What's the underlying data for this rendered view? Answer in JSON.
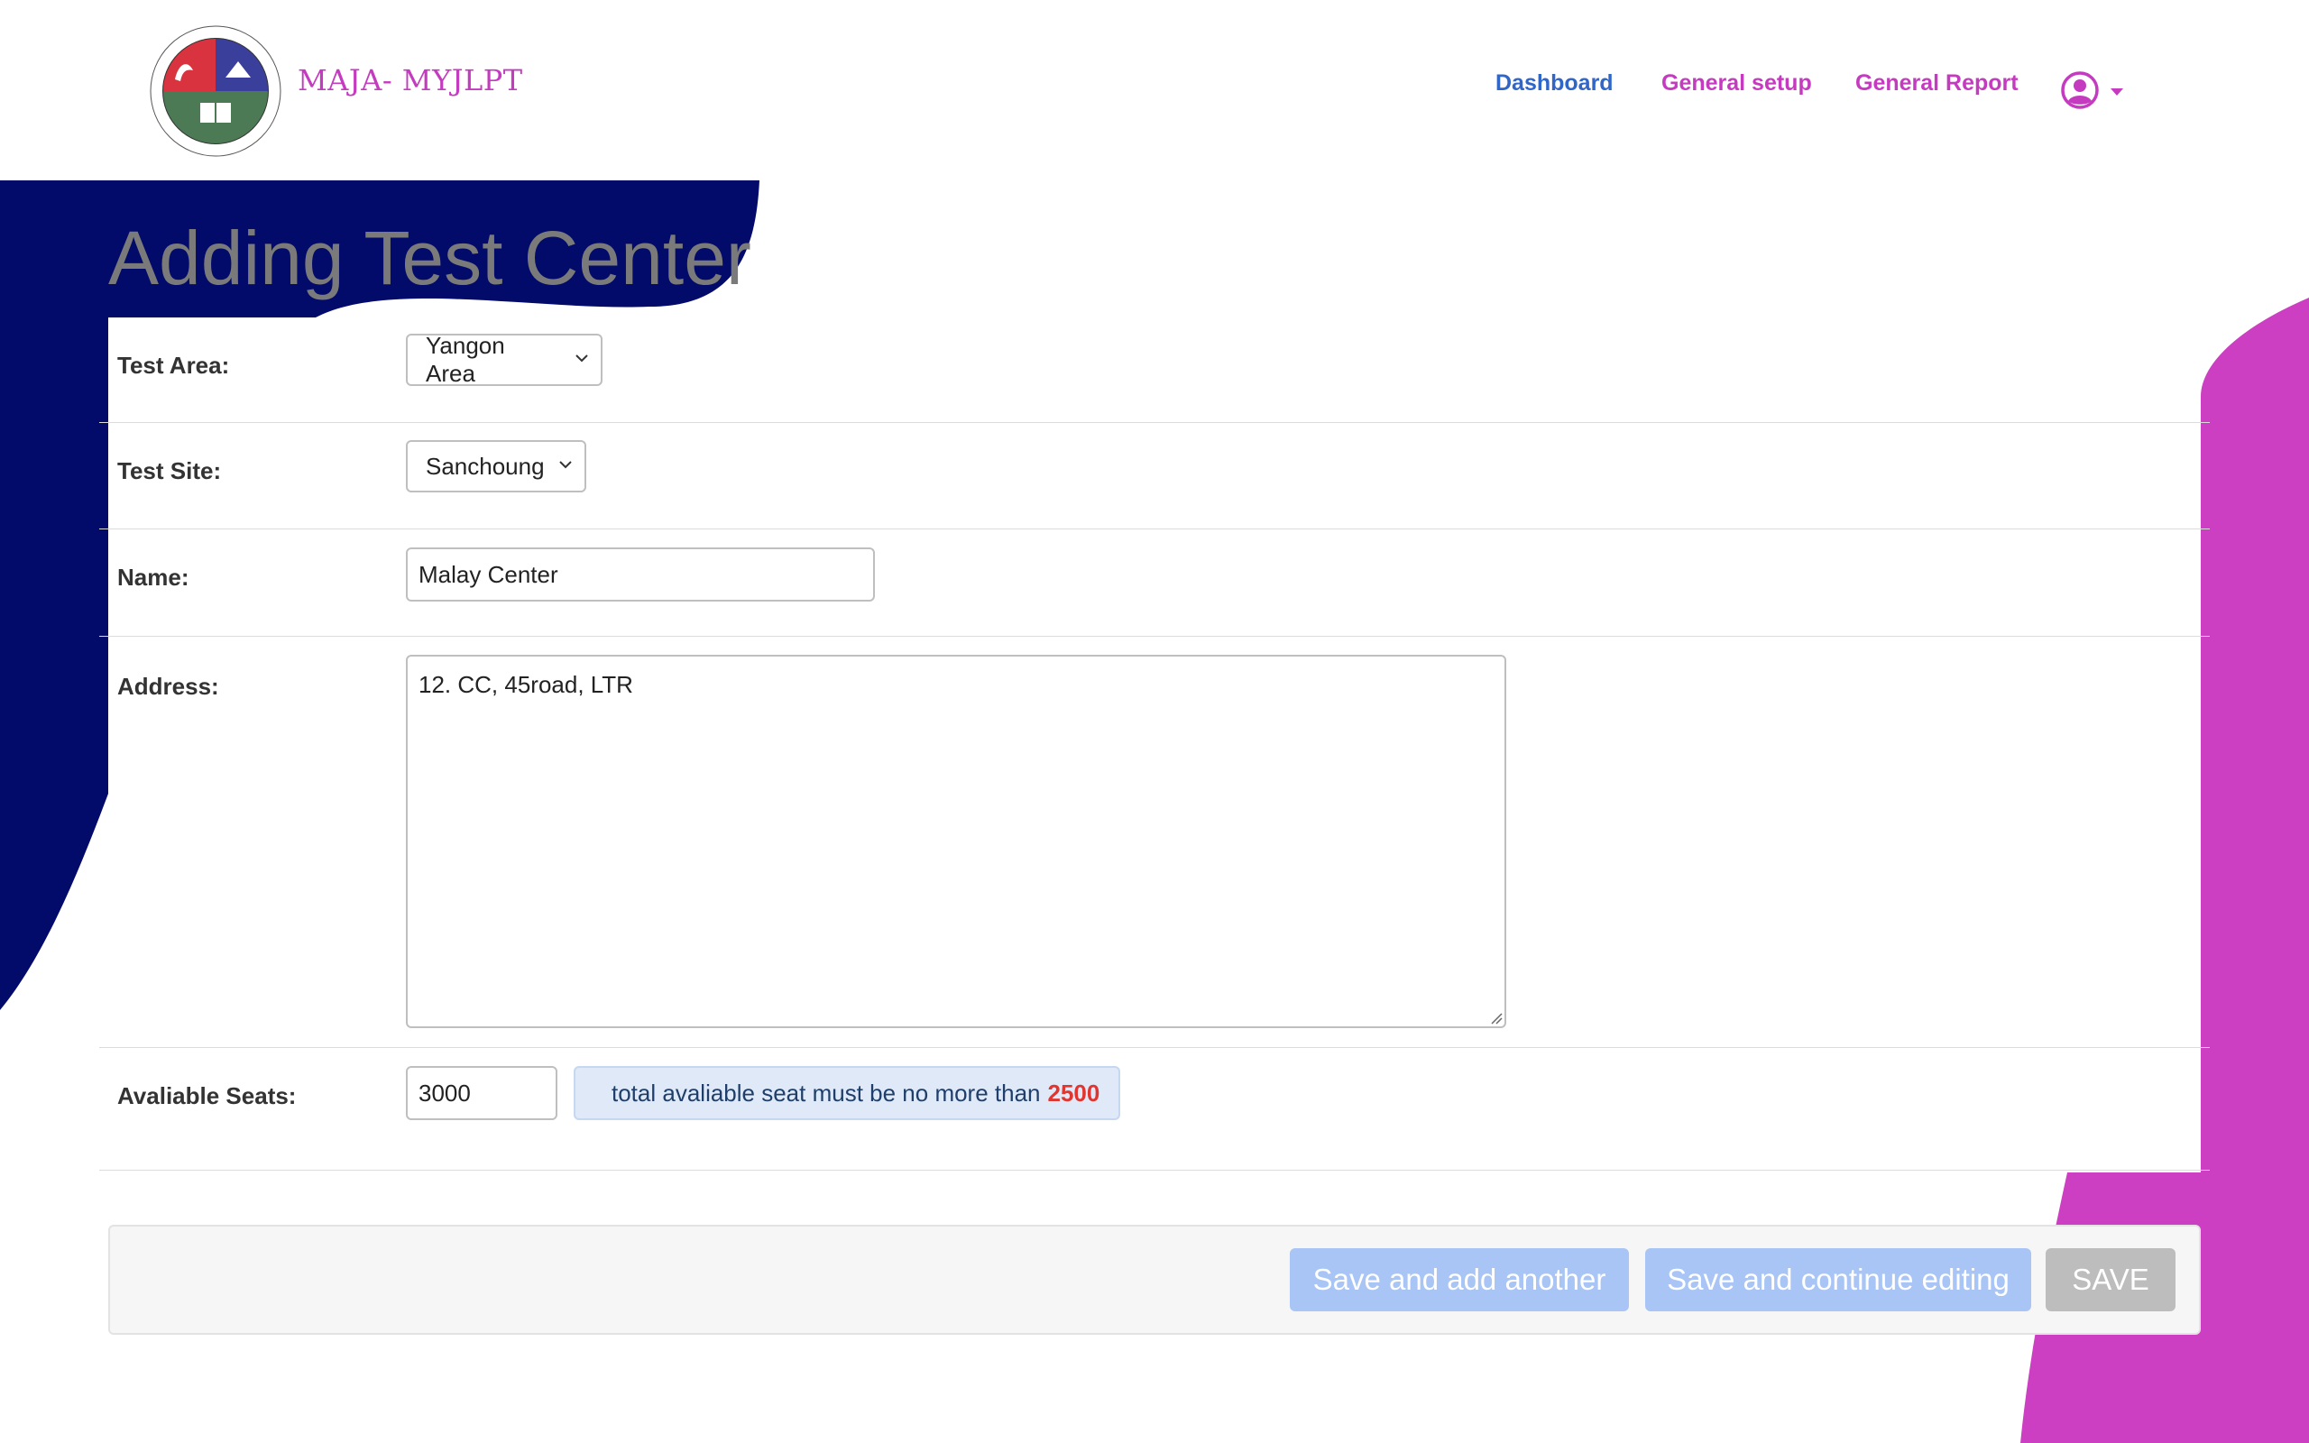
{
  "brand": {
    "name": "MAJA- MYJLPT"
  },
  "nav": {
    "dashboard": "Dashboard",
    "general_setup": "General setup",
    "general_report": "General Report",
    "user_icon": "user-circle-icon"
  },
  "page": {
    "title": "Adding Test Center"
  },
  "form": {
    "test_area": {
      "label": "Test Area:",
      "value": "Yangon Area"
    },
    "test_site": {
      "label": "Test Site:",
      "value": "Sanchoung"
    },
    "name": {
      "label": "Name:",
      "value": "Malay Center"
    },
    "address": {
      "label": "Address:",
      "value": "12. CC, 45road, LTR"
    },
    "seats": {
      "label": "Avaliable Seats:",
      "value": "3000",
      "message": "total avaliable seat must be no more than",
      "limit": "2500"
    }
  },
  "actions": {
    "save_add_another": "Save and add another",
    "save_continue": "Save and continue editing",
    "save": "SAVE"
  },
  "colors": {
    "navy": "#020a6a",
    "magenta": "#cc3fc2",
    "brand": "#c53bc0",
    "active_nav": "#2f66c8",
    "button_primary": "#a8c5f5",
    "button_save": "#bdbdbd",
    "limit_red": "#e0362f"
  }
}
